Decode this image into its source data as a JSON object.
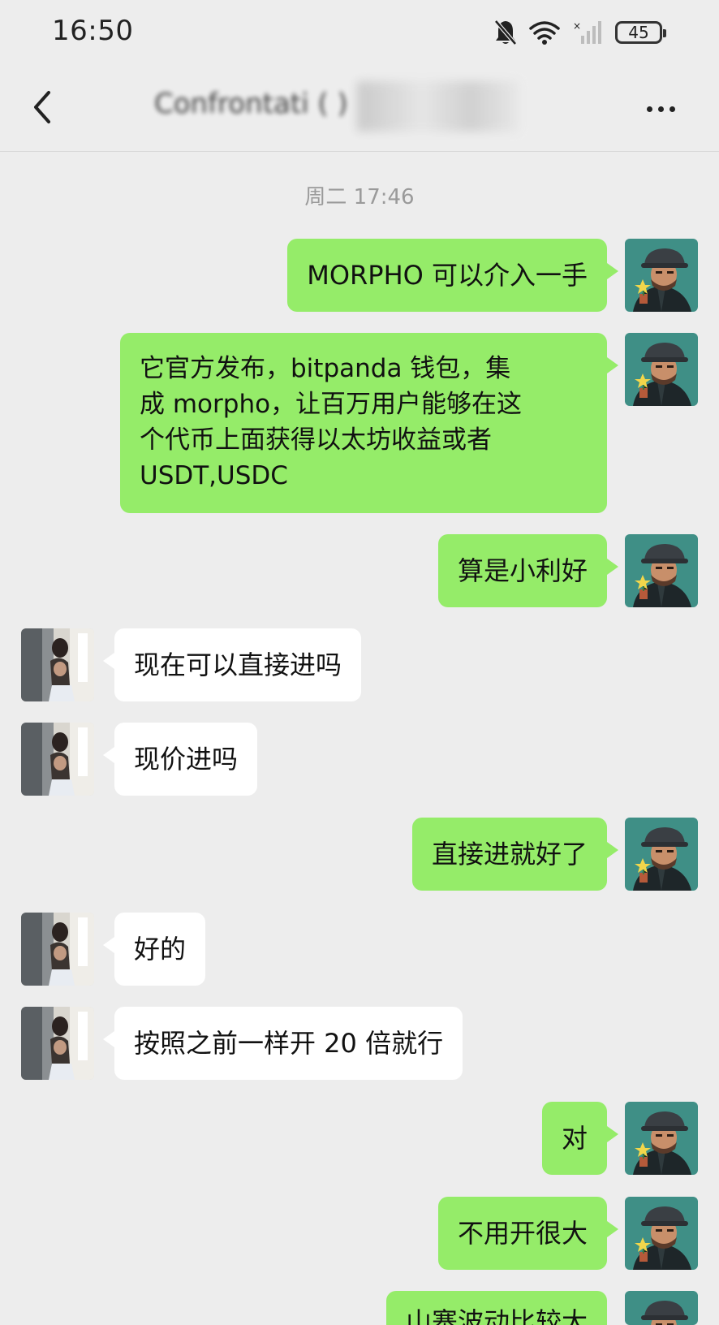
{
  "status_bar": {
    "time": "16:50",
    "battery": "45",
    "icons": [
      "bell-muted-icon",
      "wifi-icon",
      "signal-icon",
      "battery-icon"
    ]
  },
  "header": {
    "title": "Confrontati (   )",
    "back_icon": "chevron-left-icon",
    "more_icon": "more-dots-icon"
  },
  "timestamp": "周二 17:46",
  "colors": {
    "background": "#ededed",
    "my_bubble": "#95ec69",
    "their_bubble": "#ffffff"
  },
  "messages": [
    {
      "from": "me",
      "text": "MORPHO 可以介入一手"
    },
    {
      "from": "me",
      "text": "它官方发布，bitpanda 钱包，集\n成 morpho，让百万用户能够在这\n个代币上面获得以太坊收益或者\nUSDT,USDC"
    },
    {
      "from": "me",
      "text": "算是小利好"
    },
    {
      "from": "them",
      "text": "现在可以直接进吗"
    },
    {
      "from": "them",
      "text": "现价进吗"
    },
    {
      "from": "me",
      "text": "直接进就好了"
    },
    {
      "from": "them",
      "text": "好的"
    },
    {
      "from": "them",
      "text": "按照之前一样开 20 倍就行"
    },
    {
      "from": "me",
      "text": "对"
    },
    {
      "from": "me",
      "text": "不用开很大"
    },
    {
      "from": "me",
      "text": "山寨波动比较大"
    }
  ]
}
